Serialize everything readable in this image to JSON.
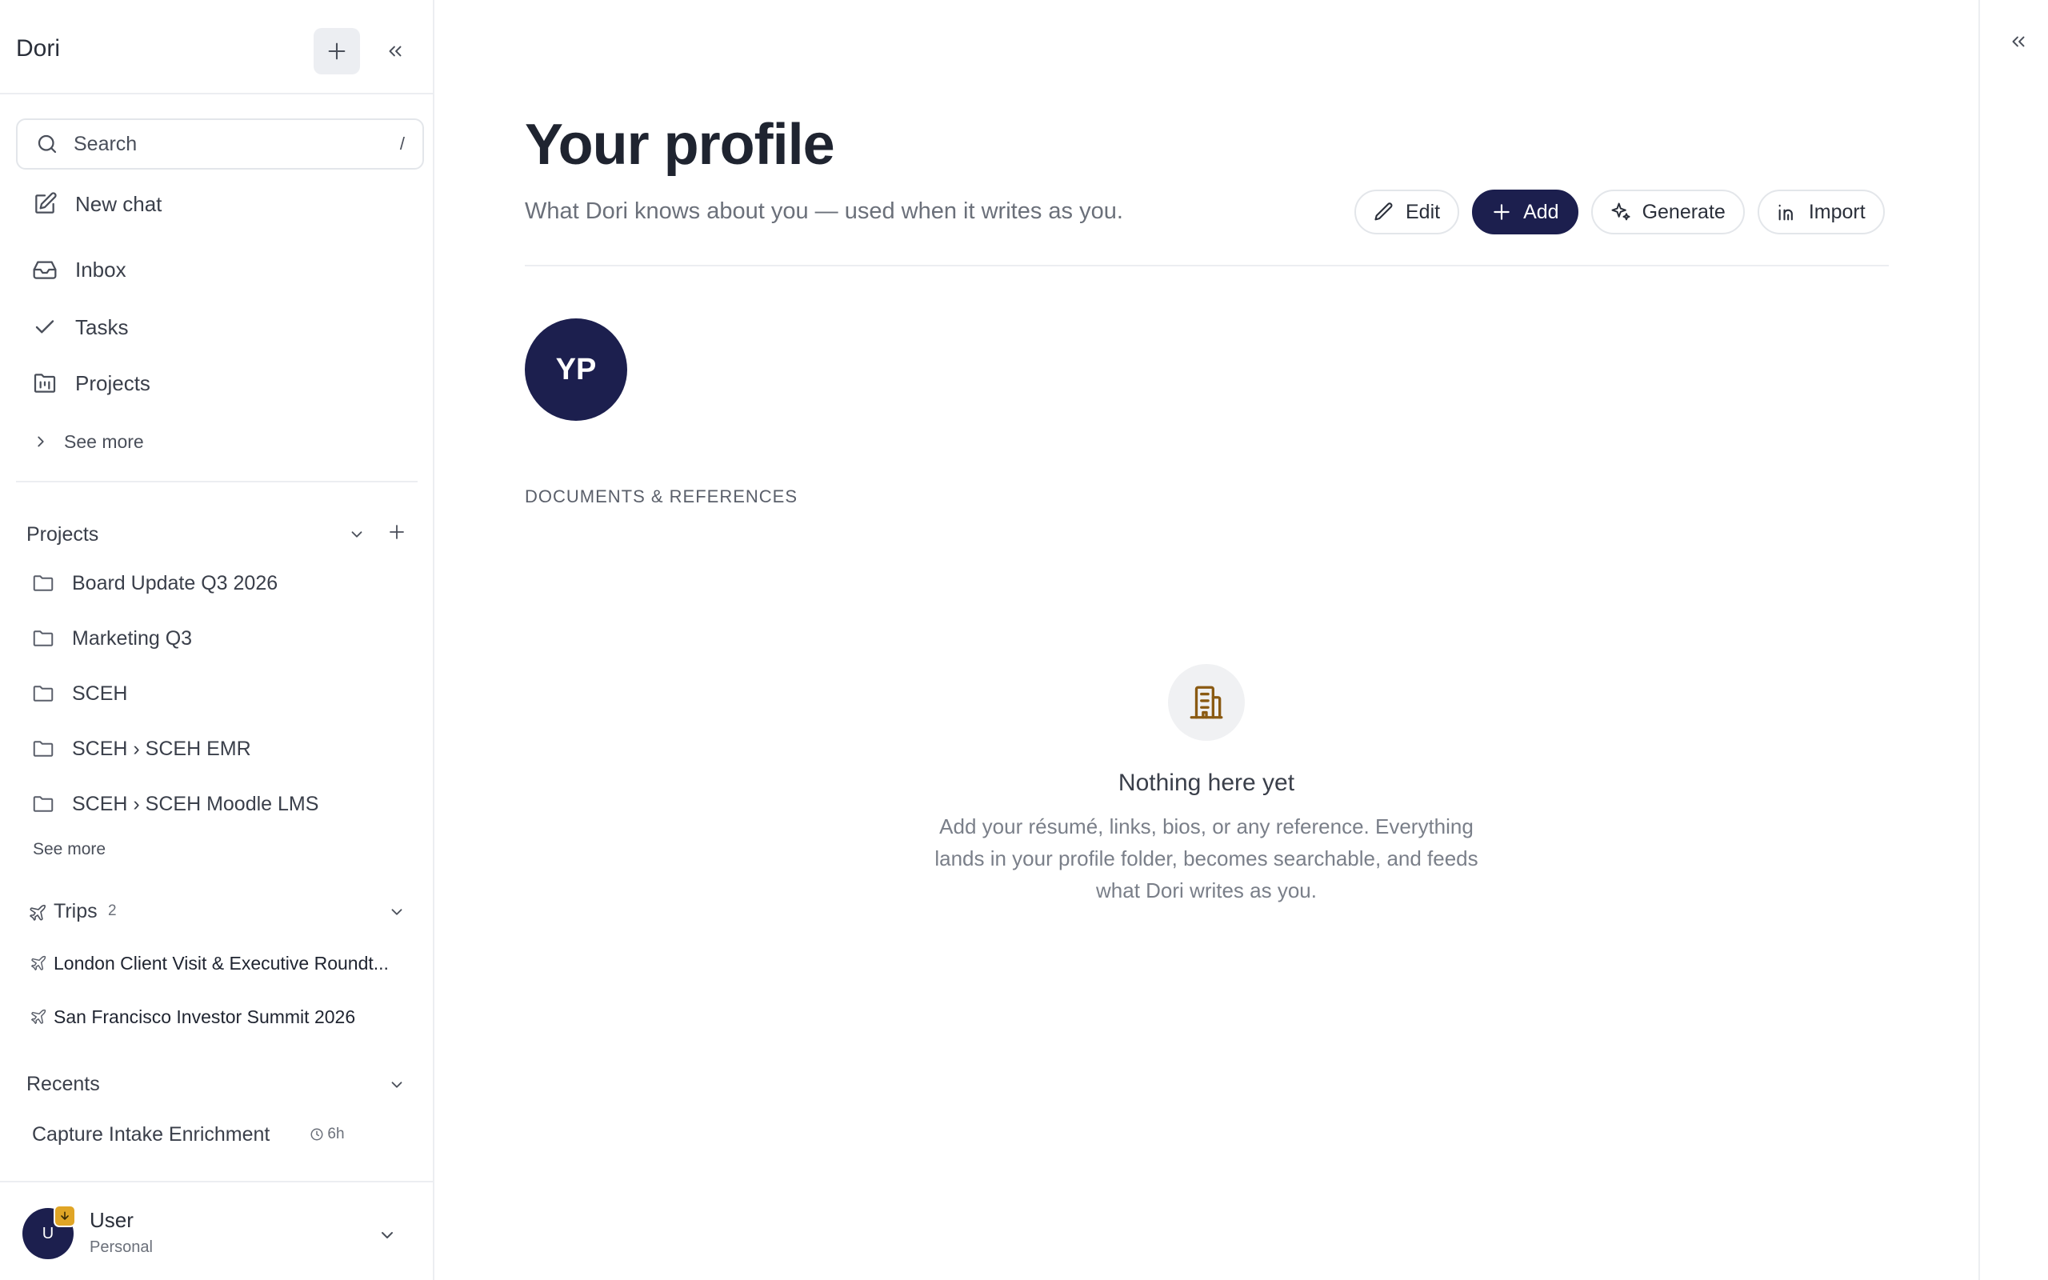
{
  "sidebar": {
    "app_name": "Dori",
    "search": {
      "placeholder": "Search",
      "shortcut": "/"
    },
    "nav": {
      "new_chat": "New chat",
      "inbox": "Inbox",
      "tasks": "Tasks",
      "projects": "Projects",
      "see_more": "See more"
    },
    "projects": {
      "title": "Projects",
      "items": [
        {
          "label": "Board Update Q3 2026"
        },
        {
          "label": "Marketing Q3"
        },
        {
          "label": "SCEH"
        },
        {
          "label": "SCEH › SCEH EMR"
        },
        {
          "label": "SCEH › SCEH Moodle LMS"
        }
      ],
      "see_more": "See more"
    },
    "trips": {
      "title": "Trips",
      "count": "2",
      "items": [
        {
          "label": "London Client Visit & Executive Roundt..."
        },
        {
          "label": "San Francisco Investor Summit 2026"
        }
      ]
    },
    "recents": {
      "title": "Recents",
      "items": [
        {
          "label": "Capture Intake Enrichment",
          "time": "6h"
        }
      ]
    },
    "user": {
      "initial": "U",
      "name": "User",
      "plan": "Personal"
    }
  },
  "main": {
    "title": "Your profile",
    "subtitle": "What Dori knows about you — used when it writes as you.",
    "actions": {
      "edit": "Edit",
      "add": "Add",
      "generate": "Generate",
      "import": "Import"
    },
    "avatar_initials": "YP",
    "section_label": "DOCUMENTS & REFERENCES",
    "empty": {
      "title": "Nothing here yet",
      "line1": "Add your résumé, links, bios, or any reference. Everything",
      "line2": "lands in your profile folder, becomes searchable, and feeds",
      "line3": "what Dori writes as you."
    }
  },
  "colors": {
    "brand_navy": "#1c1f4e",
    "badge_amber": "#e0a526",
    "empty_icon_brown": "#8a5a12"
  },
  "icons": {
    "new": "plus-icon",
    "collapse": "chevrons-left-icon",
    "search": "search-icon",
    "new_chat": "edit-square-icon",
    "inbox": "inbox-icon",
    "tasks": "check-icon",
    "projects": "kanban-folder-icon",
    "folder": "folder-icon",
    "trip": "airplane-icon",
    "clock": "clock-icon",
    "empty": "building-icon"
  }
}
